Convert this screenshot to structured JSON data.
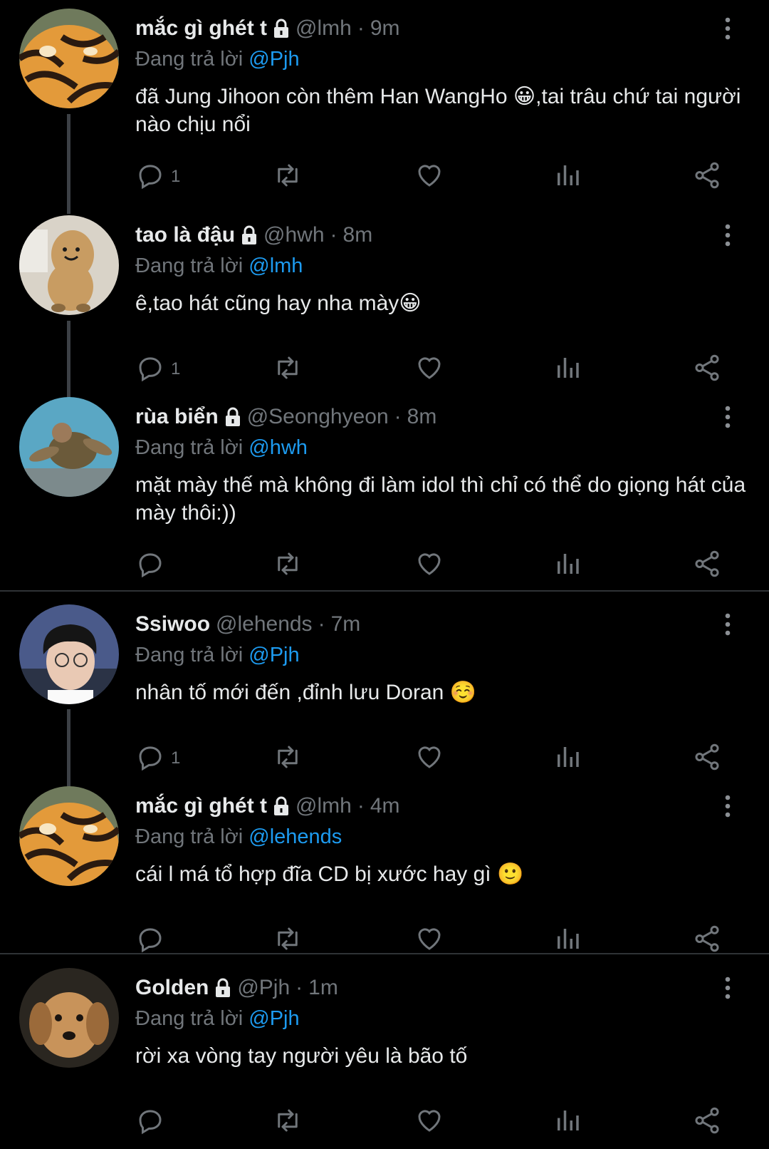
{
  "reply_prefix": "Đang trả lời",
  "tweets": [
    {
      "name": "mắc gì ghét t",
      "handle": "@lmh",
      "time": "9m",
      "reply_to": "@Pjh",
      "text": "đã Jung Jihoon còn thêm Han WangHo 😀,tai trâu chứ tai người nào chịu nổi",
      "reply_count": "1",
      "locked": true,
      "avatar": "tiger"
    },
    {
      "name": "tao là đậu",
      "handle": "@hwh",
      "time": "8m",
      "reply_to": "@lmh",
      "text": "ê,tao hát cũng hay nha mày😀",
      "reply_count": "1",
      "locked": true,
      "avatar": "peanut"
    },
    {
      "name": "rùa biển",
      "handle": "@Seonghyeon",
      "time": "8m",
      "reply_to": "@hwh",
      "text": "mặt mày thế mà không đi làm idol thì chỉ có thể do giọng hát của mày thôi:))",
      "reply_count": "",
      "locked": true,
      "avatar": "turtle"
    },
    {
      "name": "Ssiwoo",
      "handle": "@lehends",
      "time": "7m",
      "reply_to": "@Pjh",
      "text": "nhân tố mới đến ,đỉnh lưu Doran ☺️",
      "reply_count": "1",
      "locked": false,
      "avatar": "person"
    },
    {
      "name": "mắc gì ghét t",
      "handle": "@lmh",
      "time": "4m",
      "reply_to": "@lehends",
      "text": "cái l má tổ hợp đĩa CD bị xước hay gì 🙂",
      "reply_count": "",
      "locked": true,
      "avatar": "tiger"
    },
    {
      "name": "Golden",
      "handle": "@Pjh",
      "time": "1m",
      "reply_to": "@Pjh",
      "text": "rời xa vòng tay người yêu là bão tố",
      "reply_count": "",
      "locked": true,
      "avatar": "dog"
    }
  ]
}
